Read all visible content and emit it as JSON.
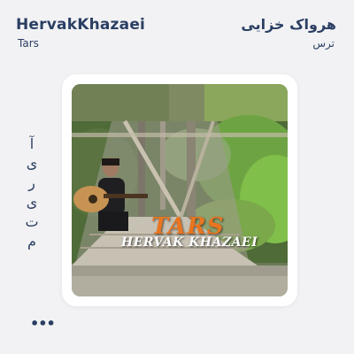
{
  "header": {
    "artist_en": "HervakKhazaei",
    "track_en": "Tars",
    "artist_fa": "هرواک خزایی",
    "track_fa": "ترس"
  },
  "side_label": {
    "letters": [
      "آ",
      "ی",
      "ر",
      "ی",
      "ت",
      "م"
    ]
  },
  "menu": {
    "more_label": "•••"
  },
  "cover": {
    "title": "TARS",
    "artist": "HERVAK KHAZAEI"
  },
  "colors": {
    "text": "#2b3f63",
    "background": "#f2f2f4",
    "title_accent": "#e8751f"
  }
}
